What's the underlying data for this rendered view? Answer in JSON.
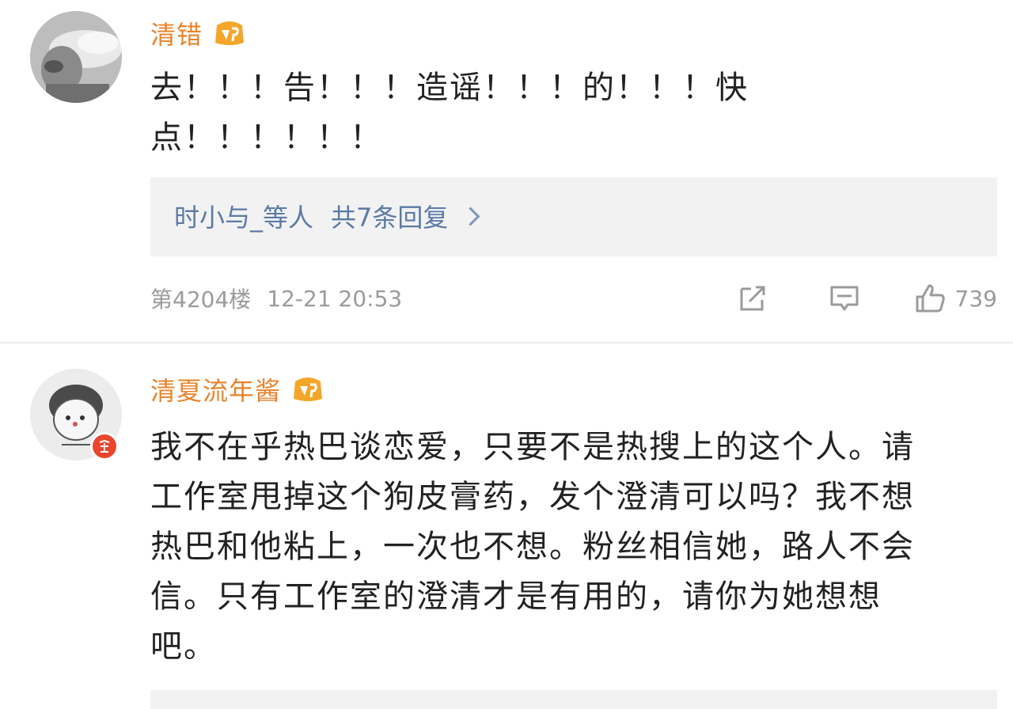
{
  "comments": [
    {
      "username": "清错",
      "text_lines": [
        "去！！！告！！！造谣！！！的！！！快",
        "点！！！！！！"
      ],
      "replies": {
        "users": "时小与_等人",
        "count_label": "共7条回复"
      },
      "floor": "第4204楼",
      "time": "12-21 20:53",
      "likes": "739"
    },
    {
      "username": "清夏流年酱",
      "text_lines": [
        "我不在乎热巴谈恋爱，只要不是热搜上的这个人。请",
        "工作室甩掉这个狗皮膏药，发个澄清可以吗？我不想",
        "热巴和他粘上，一次也不想。粉丝相信她，路人不会",
        "信。只有工作室的澄清才是有用的，请你为她想想",
        "吧。"
      ]
    }
  ],
  "colors": {
    "username": "#e8832a",
    "reply_link": "#5b7aa6",
    "meta_gray": "#9b9b9b",
    "reply_box_bg": "#f2f2f2"
  },
  "icons": [
    "vip-badge-icon",
    "share-icon",
    "comment-icon",
    "like-icon",
    "chevron-right-icon"
  ]
}
